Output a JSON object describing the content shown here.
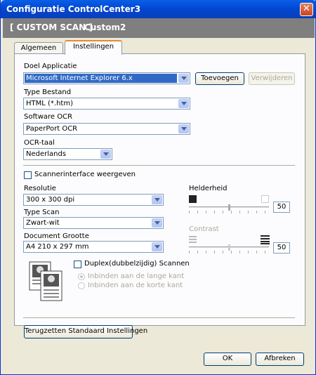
{
  "window": {
    "title": "Configuratie ControlCenter3"
  },
  "header": {
    "left": "[ CUSTOM SCAN ]",
    "right": "Custom2"
  },
  "tabs": [
    {
      "label": "Algemeen"
    },
    {
      "label": "Instellingen"
    }
  ],
  "fields": {
    "doel_label": "Doel Applicatie",
    "doel_value": "Microsoft Internet Explorer 6.x",
    "toevoegen": "Toevoegen",
    "verwijderen": "Verwijderen",
    "type_bestand_label": "Type Bestand",
    "type_bestand_value": "HTML (*.htm)",
    "ocr_software_label": "Software OCR",
    "ocr_software_value": "PaperPort OCR",
    "ocr_taal_label": "OCR-taal",
    "ocr_taal_value": "Nederlands"
  },
  "scanner_interface": "Scannerinterface weergeven",
  "settings": {
    "resolutie_label": "Resolutie",
    "resolutie_value": "300 x 300 dpi",
    "type_scan_label": "Type Scan",
    "type_scan_value": "Zwart-wit",
    "doc_grootte_label": "Document Grootte",
    "doc_grootte_value": "A4 210 x 297 mm",
    "helderheid_label": "Helderheid",
    "helderheid_value": "50",
    "helderheid_level": 0.5,
    "contrast_label": "Contrast",
    "contrast_value": "50",
    "contrast_level": 0.5
  },
  "duplex": {
    "label": "Duplex(dubbelzijdig) Scannen",
    "option_long": "Inbinden aan de lange kant",
    "option_short": "Inbinden aan de korte kant"
  },
  "reset_button": "Terugzetten Standaard Instellingen",
  "footer": {
    "ok": "OK",
    "cancel": "Afbreken"
  }
}
